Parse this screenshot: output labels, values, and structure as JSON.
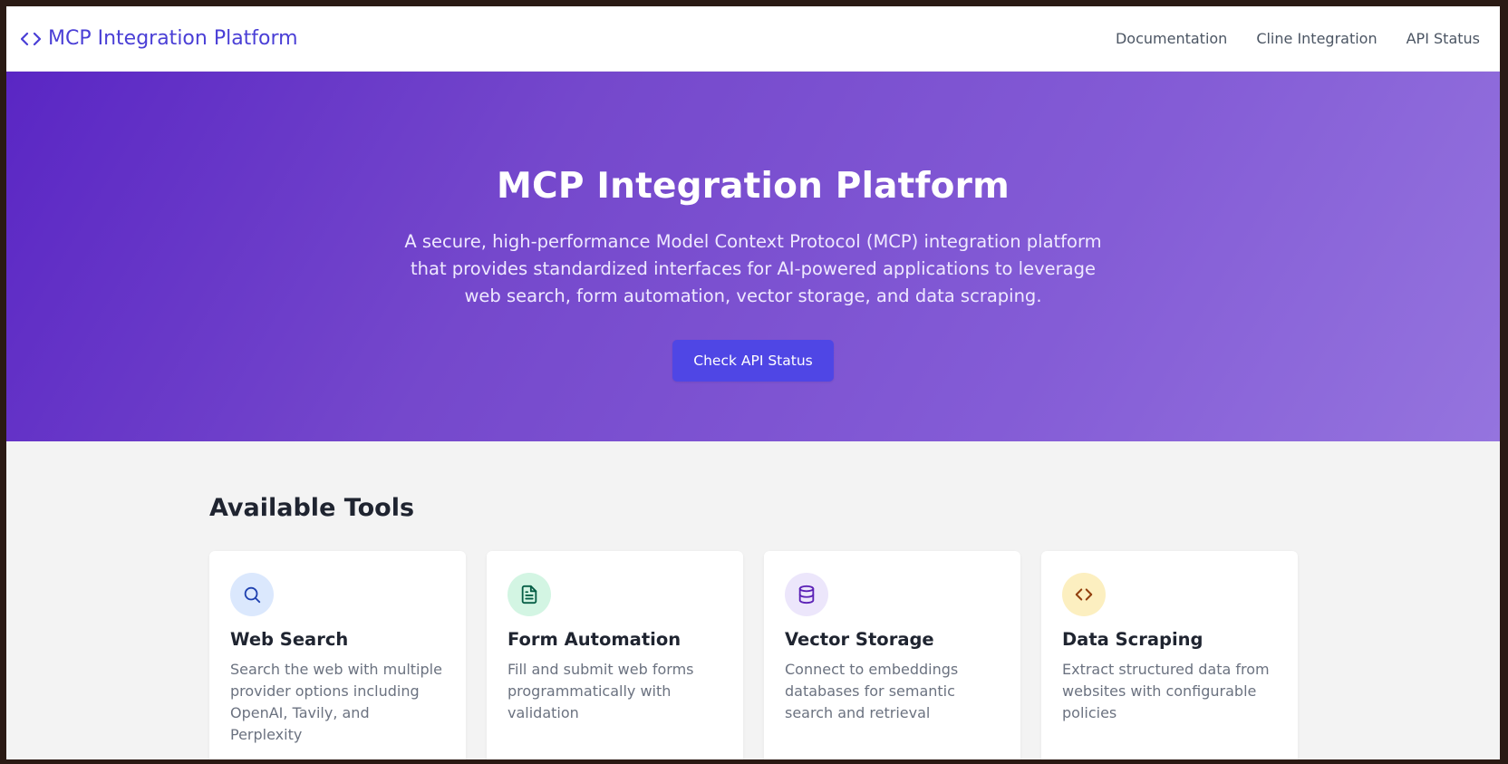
{
  "header": {
    "brand_label": "MCP Integration Platform",
    "nav": [
      {
        "label": "Documentation"
      },
      {
        "label": "Cline Integration"
      },
      {
        "label": "API Status"
      }
    ]
  },
  "hero": {
    "title": "MCP Integration Platform",
    "description": "A secure, high-performance Model Context Protocol (MCP) integration platform that provides standardized interfaces for AI-powered applications to leverage web search, form automation, vector storage, and data scraping.",
    "cta_label": "Check API Status"
  },
  "tools": {
    "heading": "Available Tools",
    "cards": [
      {
        "icon": "search-icon",
        "title": "Web Search",
        "description": "Search the web with multiple provider options including OpenAI, Tavily, and Perplexity"
      },
      {
        "icon": "document-icon",
        "title": "Form Automation",
        "description": "Fill and submit web forms programmatically with validation"
      },
      {
        "icon": "database-icon",
        "title": "Vector Storage",
        "description": "Connect to embeddings databases for semantic search and retrieval"
      },
      {
        "icon": "code-icon",
        "title": "Data Scraping",
        "description": "Extract structured data from websites with configurable policies"
      }
    ]
  },
  "colors": {
    "brand": "#4a3fd6",
    "button": "#4f46e5",
    "hero_gradient_start": "#5a26c4",
    "hero_gradient_end": "#9574de"
  }
}
